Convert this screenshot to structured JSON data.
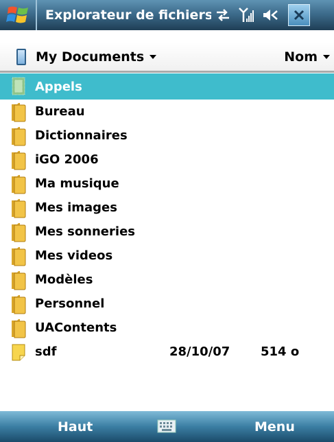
{
  "titlebar": {
    "title": "Explorateur de fichiers"
  },
  "location": {
    "folder": "My Documents",
    "sort": "Nom"
  },
  "files": [
    {
      "name": "Appels",
      "type": "folder",
      "selected": true
    },
    {
      "name": "Bureau",
      "type": "folder"
    },
    {
      "name": "Dictionnaires",
      "type": "folder"
    },
    {
      "name": "iGO 2006",
      "type": "folder"
    },
    {
      "name": "Ma musique",
      "type": "folder"
    },
    {
      "name": "Mes images",
      "type": "folder"
    },
    {
      "name": "Mes sonneries",
      "type": "folder"
    },
    {
      "name": "Mes videos",
      "type": "folder"
    },
    {
      "name": "Modèles",
      "type": "folder"
    },
    {
      "name": "Personnel",
      "type": "folder"
    },
    {
      "name": "UAContents",
      "type": "folder"
    },
    {
      "name": "sdf",
      "type": "file",
      "date": "28/10/07",
      "size": "514 o"
    }
  ],
  "softkeys": {
    "left": "Haut",
    "right": "Menu"
  },
  "colors": {
    "selection": "#3fbccc",
    "folder": "#f2c447"
  }
}
